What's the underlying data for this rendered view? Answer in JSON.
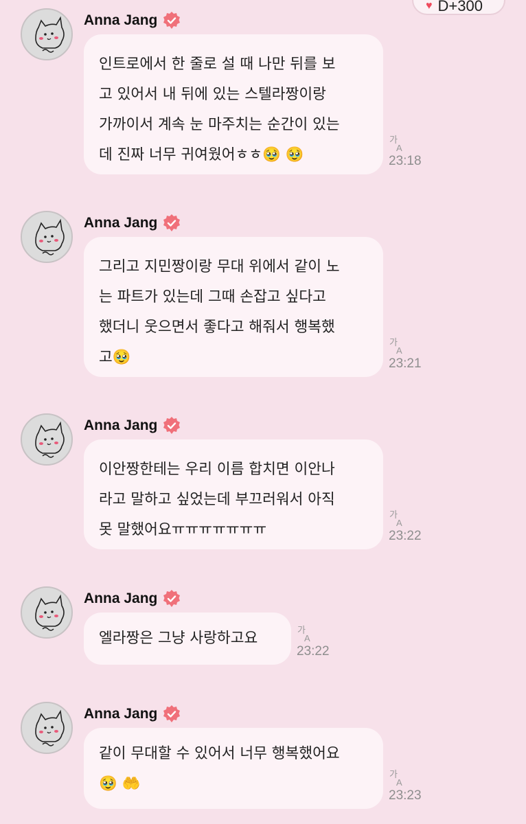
{
  "top_chip": {
    "label": "D+300"
  },
  "messages": [
    {
      "sender": "Anna Jang",
      "lines": [
        "인트로에서 한 줄로 설 때 나만 뒤를 보",
        "고 있어서 내 뒤에 있는 스텔라짱이랑",
        "가까이서 계속 눈 마주치는 순간이 있는",
        "데 진짜 너무 귀여웠어ㅎㅎ🥹 🥹"
      ],
      "time": "23:18"
    },
    {
      "sender": "Anna Jang",
      "lines": [
        "그리고 지민짱이랑 무대 위에서 같이 노",
        "는 파트가 있는데 그때 손잡고 싶다고",
        "했더니 웃으면서 좋다고 해줘서 행복했",
        "고🥹"
      ],
      "time": "23:21"
    },
    {
      "sender": "Anna Jang",
      "lines": [
        "이안짱한테는 우리 이름 합치면 이안나",
        "라고 말하고 싶었는데 부끄러워서 아직",
        "못 말했어요ㅠㅠㅠㅠㅠㅠㅠ"
      ],
      "time": "23:22"
    },
    {
      "sender": "Anna Jang",
      "lines": [
        "엘라짱은 그냥 사랑하고요"
      ],
      "time": "23:22"
    },
    {
      "sender": "Anna Jang",
      "lines": [
        "같이 무대할 수 있어서 너무 행복했어요",
        "🥹 🤲"
      ],
      "time": "23:23"
    }
  ],
  "icons": {
    "verified": "verified-badge-icon",
    "translate": "translate-icon",
    "heart": "heart-icon"
  },
  "colors": {
    "background": "#f7e1ea",
    "bubble": "#fdf3f7",
    "verified": "#f0707a",
    "timestamp": "#8e8e8e"
  }
}
